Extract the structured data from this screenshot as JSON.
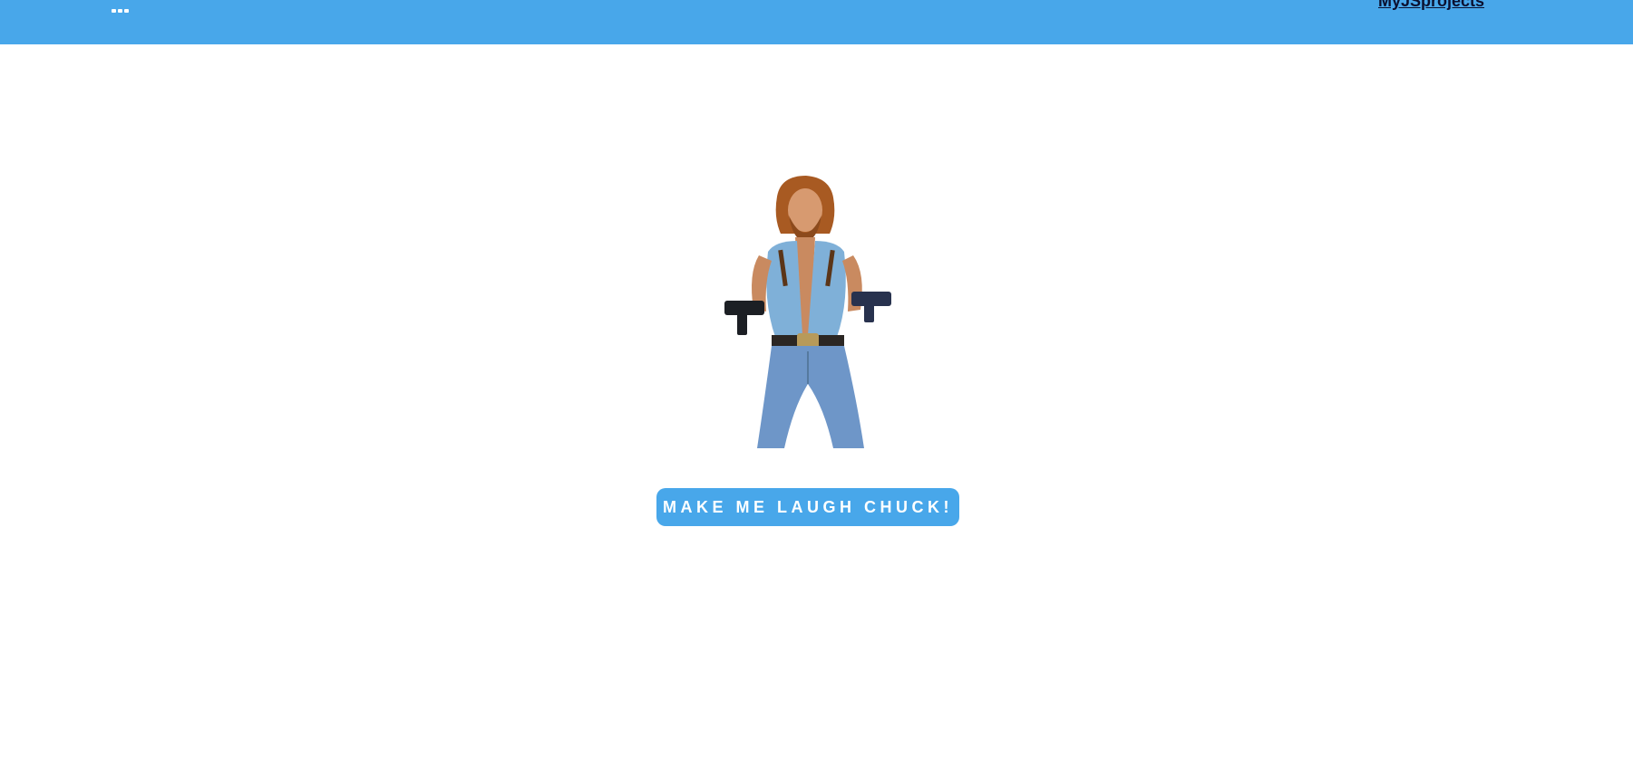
{
  "colors": {
    "accent": "#48a7ea",
    "nav_link": "#0b1030",
    "background": "#ffffff"
  },
  "header": {
    "menu_icon": "ellipsis-icon",
    "nav_link_label": "MyJSprojects"
  },
  "main": {
    "hero_image": "chuck-norris-illustration",
    "button_label": "MAKE ME LAUGH CHUCK!"
  }
}
